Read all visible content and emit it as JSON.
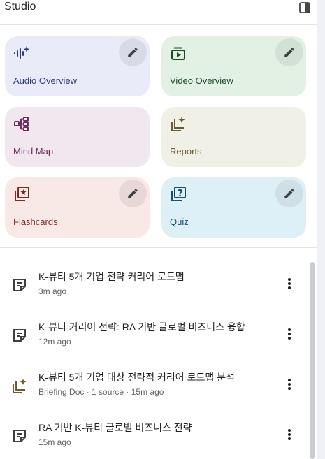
{
  "header": {
    "title": "Studio"
  },
  "cards": [
    {
      "label": "Audio Overview",
      "icon": "audio-waveform-icon",
      "color": "#2f3b76"
    },
    {
      "label": "Video Overview",
      "icon": "video-icon",
      "color": "#1e4a26"
    },
    {
      "label": "Mind Map",
      "icon": "mind-map-icon",
      "color": "#6e2d5e"
    },
    {
      "label": "Reports",
      "icon": "reports-icon",
      "color": "#6b5b35"
    },
    {
      "label": "Flashcards",
      "icon": "flashcards-icon",
      "color": "#7a2a24"
    },
    {
      "label": "Quiz",
      "icon": "quiz-icon",
      "color": "#184f69"
    }
  ],
  "notes": [
    {
      "title": "K-뷰티 5개 기업 전략 커리어 로드맵",
      "meta": "3m ago",
      "icon": "note-icon"
    },
    {
      "title": "K-뷰티 커리어 전략: RA 기반 글로벌 비즈니스 융합",
      "meta": "12m ago",
      "icon": "note-icon"
    },
    {
      "title": "K-뷰티 5개 기업 대상 전략적 커리어 로드맵 분석",
      "meta": "Briefing Doc · 1 source · 15m ago",
      "icon": "reports-icon"
    },
    {
      "title": "RA 기반 K-뷰티 글로벌 비즈니스 전략",
      "meta": "15m ago",
      "icon": "note-icon"
    }
  ]
}
